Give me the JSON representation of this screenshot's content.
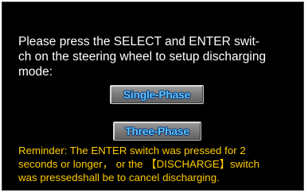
{
  "instruction": {
    "line1": "Please press the SELECT and ENTER swit-",
    "line2": "ch on the steering wheel to setup discharging",
    "line3": "mode:"
  },
  "buttons": {
    "single_phase": "Single-Phase",
    "three_phase": "Three-Phase"
  },
  "reminder": {
    "line1": "Reminder: The ENTER switch was pressed for 2",
    "line2": "seconds or longer， or the 【DISCHARGE】switch",
    "line3": "was pressedshall be to cancel discharging."
  },
  "colors": {
    "background": "#000000",
    "instruction_text": "#ffffff",
    "reminder_text": "#ffcc00",
    "button_label": "#5fc8ff"
  }
}
